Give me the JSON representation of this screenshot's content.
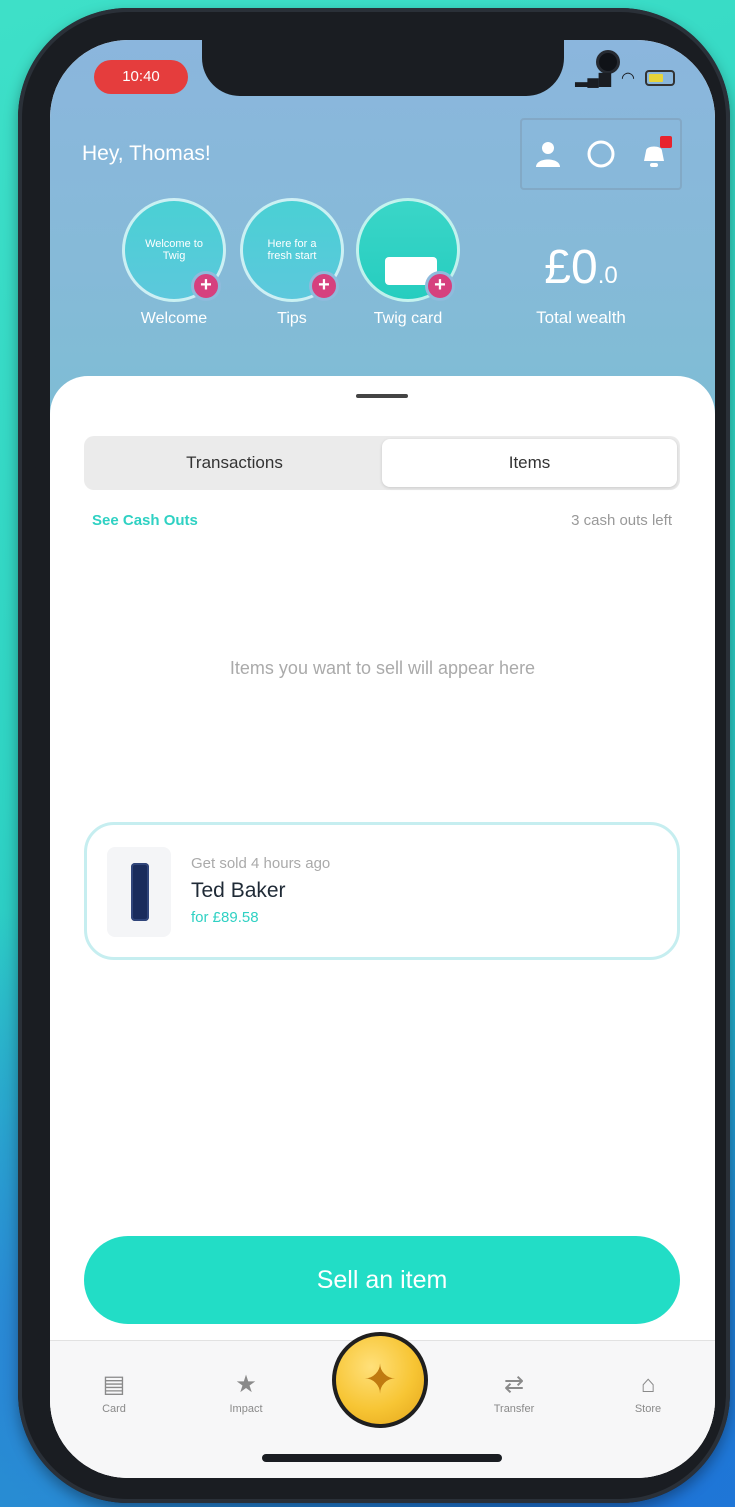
{
  "status_bar": {
    "time": "10:40"
  },
  "header": {
    "greeting": "Hey, Thomas!",
    "actions": [
      "profile-icon",
      "chat-icon",
      "bell-icon"
    ],
    "stories": [
      {
        "text": "Welcome to Twig",
        "label": "Welcome"
      },
      {
        "text": "Here for a fresh start",
        "label": "Tips"
      },
      {
        "text": "",
        "label": "Twig card"
      }
    ],
    "wealth": {
      "amount": "£0",
      "decimal": ".0",
      "label": "Total wealth"
    }
  },
  "sheet": {
    "tabs": [
      {
        "label": "Transactions",
        "active": false
      },
      {
        "label": "Items",
        "active": true
      }
    ],
    "see_cash_outs": "See Cash Outs",
    "cash_outs_left": "3 cash outs left",
    "empty_message": "Items you want to sell will appear here",
    "item": {
      "status": "Get sold 4 hours ago",
      "brand": "Ted Baker",
      "price": "for £89.58"
    },
    "sell_button": "Sell an item"
  },
  "tab_bar": [
    {
      "label": "Card",
      "icon": "card-icon"
    },
    {
      "label": "Impact",
      "icon": "star-icon"
    },
    {
      "label": "",
      "icon": "twig-coin-icon"
    },
    {
      "label": "Transfer",
      "icon": "transfer-icon"
    },
    {
      "label": "Store",
      "icon": "store-icon"
    }
  ],
  "colors": {
    "accent": "#22ddc6",
    "time_pill": "#e53d3d",
    "plus_badge": "#d6407e"
  }
}
